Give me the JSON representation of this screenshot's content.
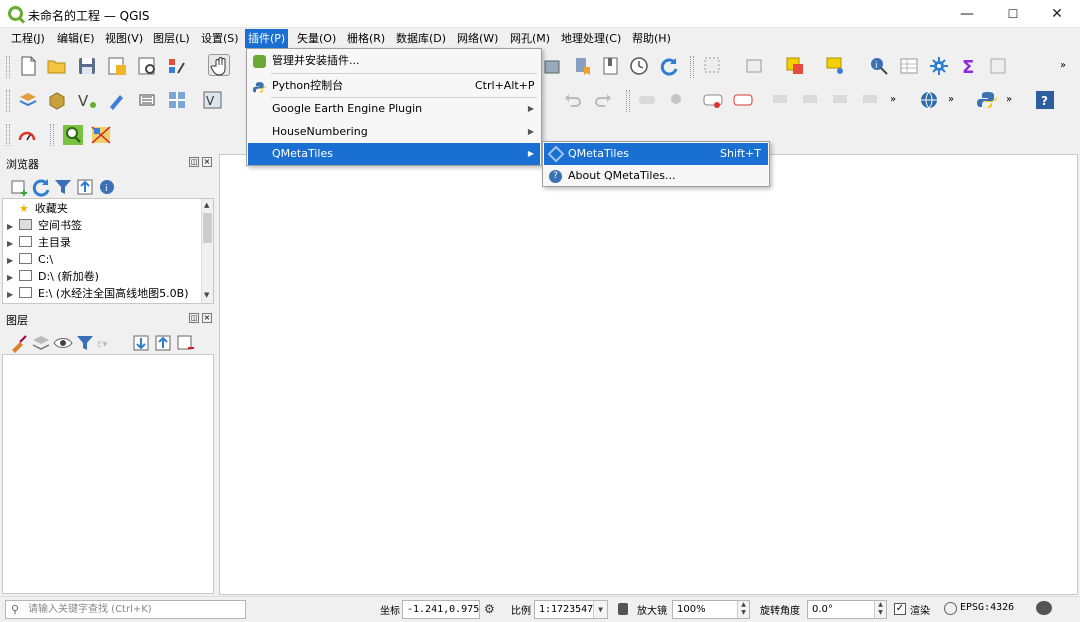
{
  "window": {
    "title": "未命名的工程 — QGIS",
    "minimize": "—",
    "maximize": "☐",
    "close": "✕"
  },
  "menubar": [
    "工程(J)",
    "编辑(E)",
    "视图(V)",
    "图层(L)",
    "设置(S)",
    "插件(P)",
    "矢量(O)",
    "栅格(R)",
    "数据库(D)",
    "网络(W)",
    "网孔(M)",
    "地理处理(C)",
    "帮助(H)"
  ],
  "plugins_menu": {
    "items": [
      {
        "label": "管理并安装插件...",
        "shortcut": "",
        "submenu": false
      },
      {
        "label": "Python控制台",
        "shortcut": "Ctrl+Alt+P",
        "submenu": false
      },
      {
        "label": "Google Earth Engine Plugin",
        "shortcut": "",
        "submenu": true
      },
      {
        "label": "HouseNumbering",
        "shortcut": "",
        "submenu": true
      },
      {
        "label": "QMetaTiles",
        "shortcut": "",
        "submenu": true
      }
    ],
    "submenu_arrow": "▶"
  },
  "qmetatiles_submenu": {
    "items": [
      {
        "label": "QMetaTiles",
        "shortcut": "Shift+T"
      },
      {
        "label": "About QMetaTiles..."
      }
    ]
  },
  "browser_panel": {
    "title": "浏览器",
    "items": [
      {
        "label": "收藏夹",
        "icon": "star-icon",
        "expandable": false
      },
      {
        "label": "空间书签",
        "icon": "bookmark-icon",
        "expandable": true
      },
      {
        "label": "主目录",
        "icon": "home-folder-icon",
        "expandable": true
      },
      {
        "label": "C:\\",
        "icon": "drive-icon",
        "expandable": true
      },
      {
        "label": "D:\\ (新加卷)",
        "icon": "drive-icon",
        "expandable": true
      },
      {
        "label": "E:\\ (水经注全国高线地图5.0B)",
        "icon": "drive-icon",
        "expandable": true
      }
    ]
  },
  "layers_panel": {
    "title": "图层"
  },
  "status": {
    "search_placeholder": "请输入关键字查找 (Ctrl+K)",
    "coord_label": "坐标",
    "coord_value": "-1.241,0.975",
    "scale_label": "比例",
    "scale_value": "1:1723547",
    "magnifier_label": "放大镜",
    "magnifier_value": "100%",
    "rotation_label": "旋转角度",
    "rotation_value": "0.0°",
    "render_label": "渲染",
    "render_checked": true,
    "crs": "EPSG:4326"
  },
  "colors": {
    "accent": "#1a6fd3",
    "qgis_green": "#6aaa32"
  }
}
